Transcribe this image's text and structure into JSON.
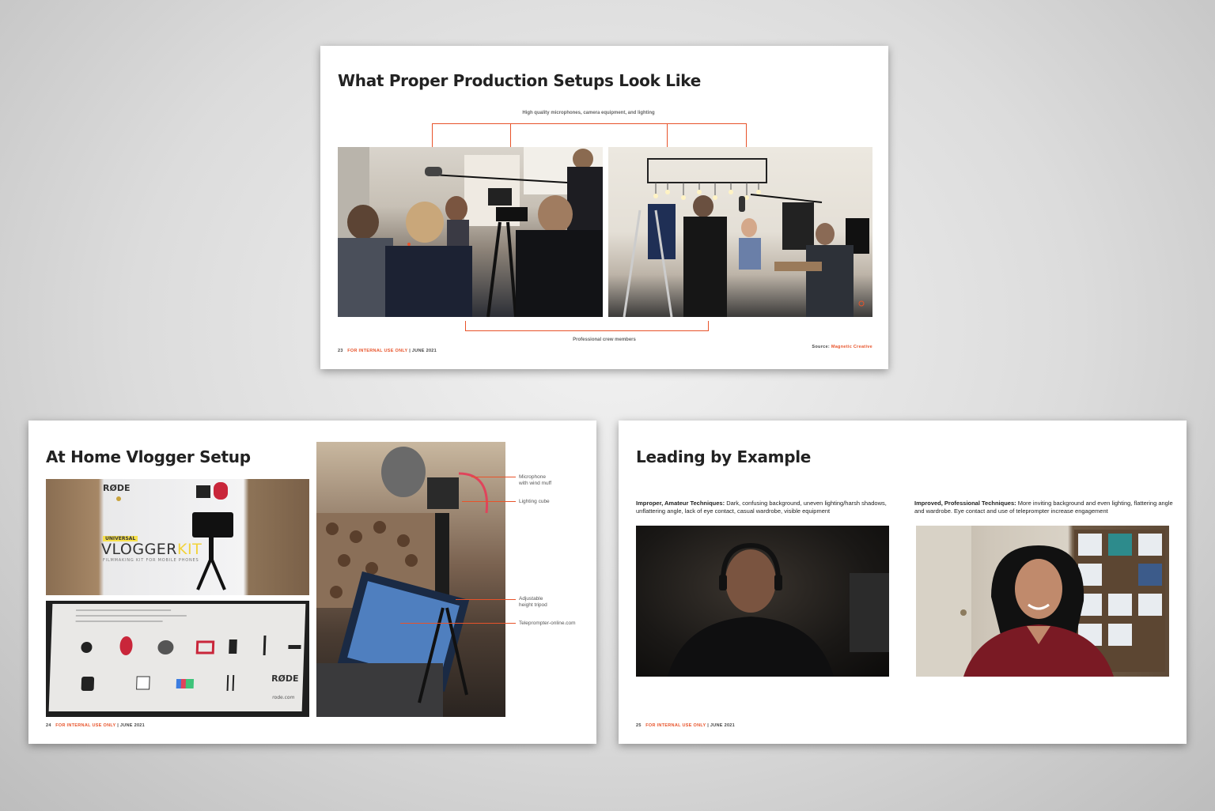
{
  "slide1": {
    "title": "What Proper Production Setups Look Like",
    "top_callout": "High quality microphones, camera equipment, and lighting",
    "bottom_callout": "Professional crew members",
    "page_number": "23",
    "footer_label": "FOR INTERNAL USE ONLY",
    "footer_date": "| JUNE 2021",
    "source_label": "Source:",
    "source_value": "Magnetic Creative"
  },
  "slide2": {
    "title": "At Home Vlogger Setup",
    "callouts": [
      "Microphone\nwith wind muff",
      "Lighting cube",
      "Adjustable\nheight tripod",
      "Teleprompter-online.com"
    ],
    "box_brand": "RØDE",
    "box_tag": "UNIVERSAL",
    "box_vlogger": "VLOGGER",
    "box_kit": "KIT",
    "box_sub": "FILMMAKING KIT FOR MOBILE PHONES",
    "box_url": "rode.com",
    "page_number": "24",
    "footer_label": "FOR INTERNAL USE ONLY",
    "footer_date": "| JUNE 2021"
  },
  "slide3": {
    "title": "Leading by Example",
    "left_caption_bold": "Improper, Amateur Techniques:",
    "left_caption": " Dark, confusing background, uneven lighting/harsh shadows, unflattering angle, lack of eye contact, casual wardrobe, visible equipment",
    "right_caption_bold": "Improved, Professional Techniques:",
    "right_caption": " More inviting background and even lighting, flattering angle and wardrobe. Eye contact and use of teleprompter increase engagement",
    "page_number": "25",
    "footer_label": "FOR INTERNAL USE ONLY",
    "footer_date": "| JUNE 2021"
  },
  "colors": {
    "accent": "#e8532a",
    "title_text": "#222222"
  }
}
